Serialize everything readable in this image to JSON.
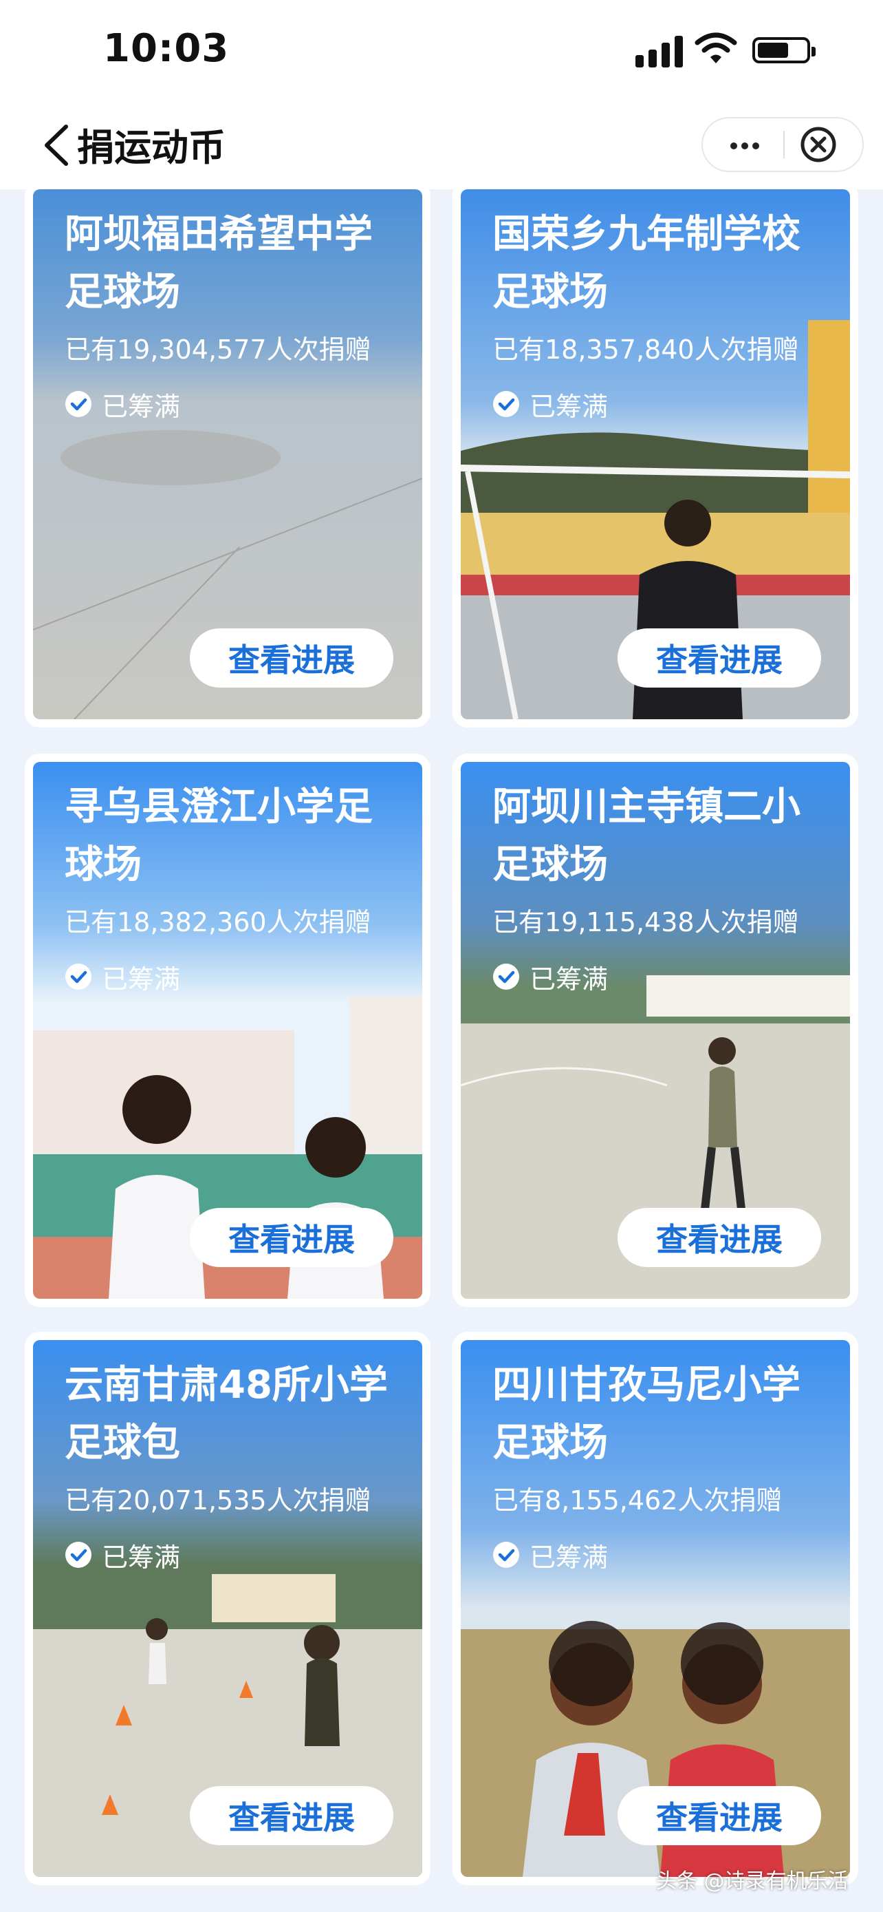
{
  "status_bar": {
    "time": "10:03"
  },
  "nav": {
    "title": "捐运动币",
    "more_icon": "more-dots-icon",
    "close_icon": "close-circle-icon"
  },
  "cards": [
    {
      "title": "阿坝福田希望中学足球场",
      "donors": "已有19,304,577人次捐赠",
      "status": "已筹满",
      "button": "查看进展"
    },
    {
      "title": "国荣乡九年制学校足球场",
      "donors": "已有18,357,840人次捐赠",
      "status": "已筹满",
      "button": "查看进展"
    },
    {
      "title": "寻乌县澄江小学足球场",
      "donors": "已有18,382,360人次捐赠",
      "status": "已筹满",
      "button": "查看进展"
    },
    {
      "title": "阿坝川主寺镇二小足球场",
      "donors": "已有19,115,438人次捐赠",
      "status": "已筹满",
      "button": "查看进展"
    },
    {
      "title": "云南甘肃48所小学足球包",
      "donors": "已有20,071,535人次捐赠",
      "status": "已筹满",
      "button": "查看进展"
    },
    {
      "title": "四川甘孜马尼小学足球场",
      "donors": "已有8,155,462人次捐赠",
      "status": "已筹满",
      "button": "查看进展"
    }
  ],
  "watermark": "头条 @诗录有机乐活",
  "colors": {
    "accent_blue": "#1a6fd8",
    "card_sky": "#3b8ef0",
    "page_bg": "#eef3fb"
  }
}
